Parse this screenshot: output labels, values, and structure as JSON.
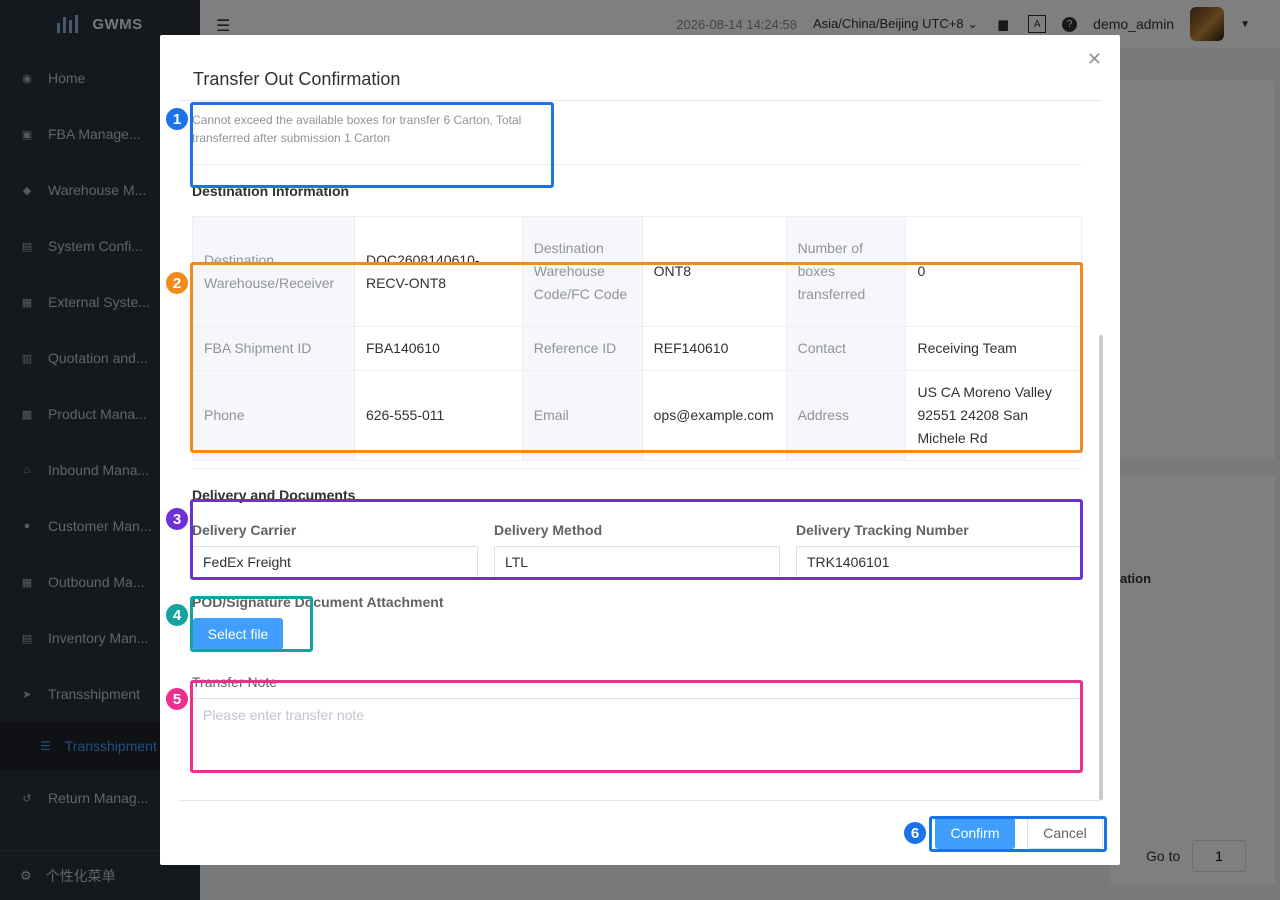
{
  "app": {
    "logo": "GWMS"
  },
  "header": {
    "datetime": "2026-08-14 14:24:58",
    "timezone": "Asia/China/Beijing UTC+8",
    "username": "demo_admin"
  },
  "sidebar": {
    "items": [
      {
        "label": "Home",
        "icon": "dashboard-icon"
      },
      {
        "label": "FBA Manage...",
        "icon": "box-icon"
      },
      {
        "label": "Warehouse M...",
        "icon": "warehouse-icon"
      },
      {
        "label": "System Confi...",
        "icon": "settings-icon"
      },
      {
        "label": "External Syste...",
        "icon": "grid-icon"
      },
      {
        "label": "Quotation and...",
        "icon": "document-icon"
      },
      {
        "label": "Product Mana...",
        "icon": "cart-icon"
      },
      {
        "label": "Inbound Mana...",
        "icon": "home-icon"
      },
      {
        "label": "Customer Man...",
        "icon": "user-icon"
      },
      {
        "label": "Outbound Ma...",
        "icon": "grid-icon"
      },
      {
        "label": "Inventory Man...",
        "icon": "table-icon"
      },
      {
        "label": "Transshipment",
        "icon": "send-icon"
      }
    ],
    "sub_item": "Transshipment",
    "after_items": [
      {
        "label": "Return Manag...",
        "icon": "return-icon"
      }
    ],
    "bottom": "个性化菜单"
  },
  "background": {
    "col_header": "ation",
    "goto_label": "Go to",
    "goto_value": "1"
  },
  "modal": {
    "title": "Transfer Out Confirmation",
    "notice": "Cannot exceed the available boxes for transfer 6 Carton,  Total transferred after submission 1 Carton",
    "destination_section": "Destination Information",
    "table": [
      [
        {
          "label": "Destination Warehouse/Receiver",
          "value": "DOC2608140610-RECV-ONT8"
        },
        {
          "label": "Destination Warehouse Code/FC Code",
          "value": "ONT8"
        },
        {
          "label": "Number of boxes transferred",
          "value": "0"
        }
      ],
      [
        {
          "label": "FBA Shipment ID",
          "value": "FBA140610"
        },
        {
          "label": "Reference ID",
          "value": "REF140610"
        },
        {
          "label": "Contact",
          "value": "Receiving Team"
        }
      ],
      [
        {
          "label": "Phone",
          "value": "626-555-011"
        },
        {
          "label": "Email",
          "value": "ops@example.com"
        },
        {
          "label": "Address",
          "value": "US CA Moreno Valley 92551 24208 San Michele Rd"
        }
      ]
    ],
    "delivery_section": "Delivery and Documents",
    "carrier_label": "Delivery Carrier",
    "carrier_value": "FedEx Freight",
    "method_label": "Delivery Method",
    "method_value": "LTL",
    "tracking_label": "Delivery Tracking Number",
    "tracking_value": "TRK1406101",
    "pod_label": "POD/Signature Document Attachment",
    "select_file": "Select file",
    "note_label": "Transfer Note",
    "note_placeholder": "Please enter transfer note",
    "confirm": "Confirm",
    "cancel": "Cancel"
  },
  "annotations": {
    "badges": [
      "1",
      "2",
      "3",
      "4",
      "5",
      "6"
    ],
    "colors": [
      "#1a73e8",
      "#f08c1e",
      "#6f2fd6",
      "#14a3a3",
      "#e8318f",
      "#1a73e8"
    ]
  }
}
